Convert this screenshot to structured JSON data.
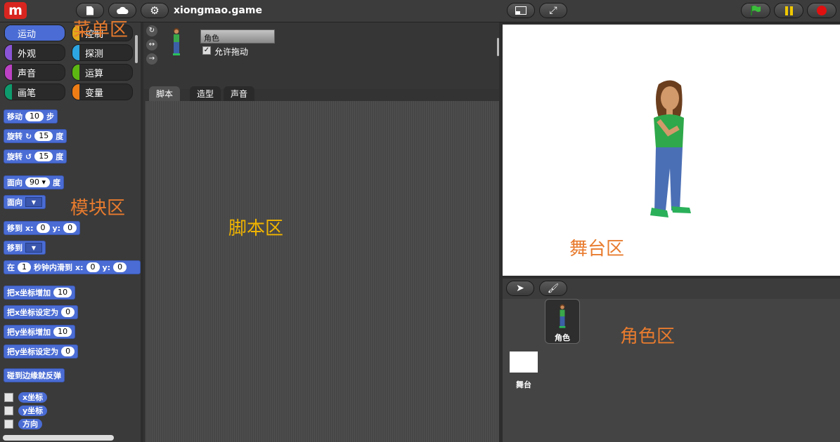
{
  "topbar": {
    "logo": "m",
    "title": "xiongmao.game"
  },
  "categories": [
    {
      "label": "运动",
      "color": "#4a6cd4",
      "selected": true
    },
    {
      "label": "控制",
      "color": "#e1a91a"
    },
    {
      "label": "外观",
      "color": "#8a55d7"
    },
    {
      "label": "探测",
      "color": "#2ca5e2"
    },
    {
      "label": "声音",
      "color": "#bb42c3"
    },
    {
      "label": "运算",
      "color": "#5cb712"
    },
    {
      "label": "画笔",
      "color": "#0e9a6c"
    },
    {
      "label": "变量",
      "color": "#ee7d16"
    }
  ],
  "blocks": {
    "move": {
      "a": "移动",
      "v": "10",
      "b": "步"
    },
    "turn_cw": {
      "a": "旋转",
      "v": "15",
      "b": "度"
    },
    "turn_ccw": {
      "a": "旋转",
      "v": "15",
      "b": "度"
    },
    "point_dir": {
      "a": "面向",
      "v": "90",
      "b": "度"
    },
    "point_towards": {
      "a": "面向"
    },
    "goto_xy": {
      "a": "移到",
      "x": "x:",
      "xv": "0",
      "y": "y:",
      "yv": "0"
    },
    "goto": {
      "a": "移到"
    },
    "glide": {
      "a": "在",
      "v": "1",
      "b": "秒钟内滑到",
      "x": "x:",
      "xv": "0",
      "y": "y:",
      "yv": "0"
    },
    "change_x": {
      "a": "把x坐标增加",
      "v": "10"
    },
    "set_x": {
      "a": "把x坐标设定为",
      "v": "0"
    },
    "change_y": {
      "a": "把y坐标增加",
      "v": "10"
    },
    "set_y": {
      "a": "把y坐标设定为",
      "v": "0"
    },
    "bounce": {
      "a": "碰到边缘就反弹"
    }
  },
  "reporters": [
    "x坐标",
    "y坐标",
    "方向"
  ],
  "sprite": {
    "name": "角色",
    "draggable_label": "允许拖动",
    "draggable": true
  },
  "tabs": [
    "脚本",
    "造型",
    "声音"
  ],
  "corral": {
    "sprite_label": "角色",
    "stage_label": "舞台"
  },
  "overlays": {
    "menu": "菜单区",
    "blocks": "模块区",
    "scripts": "脚本区",
    "stage": "舞台区",
    "sprites": "角色区"
  }
}
